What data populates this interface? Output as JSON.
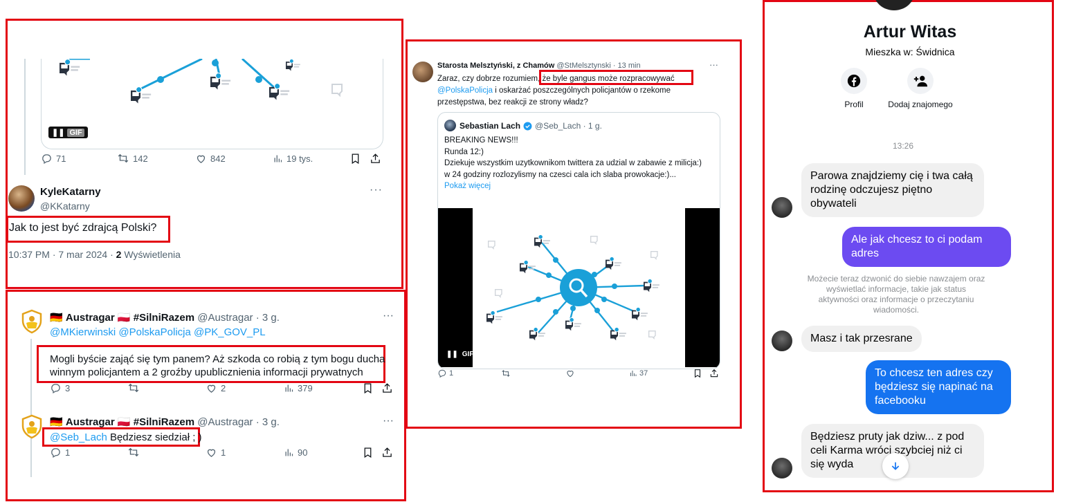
{
  "panel1": {
    "gif_label": "GIF",
    "stats": {
      "replies": "71",
      "retweets": "142",
      "likes": "842",
      "views": "19 tys."
    },
    "user": {
      "name": "KyleKatarny",
      "handle": "@KKatarny"
    },
    "tweet_text": "Jak to jest być zdrajcą Polski?",
    "time": "10:37 PM · 7 mar 2024 · ",
    "views_count": "2",
    "views_label": " Wyświetlenia"
  },
  "panel2": {
    "reply1": {
      "flag_de": "🇩🇪",
      "name": "Austragar",
      "flag_pl": "🇵🇱",
      "hashtag": "#SilniRazem",
      "handle_time": "@Austragar · 3 g.",
      "mentions": "@MKierwinski @PolskaPolicja @PK_GOV_PL",
      "text_line1": "Mogli byście zająć się tym panem? Aż szkoda co robią z tym bogu ducha",
      "text_line2": "winnym policjantem a 2 groźby upublicznienia informacji prywatnych",
      "stats": {
        "replies": "3",
        "retweets": "",
        "likes": "2",
        "views": "379"
      }
    },
    "reply2": {
      "name": "Austragar",
      "hashtag": "#SilniRazem",
      "handle_time": "@Austragar · 3 g.",
      "mention": "@Seb_Lach",
      "text": " Będziesz siedział ; )",
      "stats": {
        "replies": "1",
        "retweets": "",
        "likes": "1",
        "views": "90"
      }
    }
  },
  "panel3": {
    "header_name": "Starosta Melsztyński, z Chamów",
    "header_handle": "@StMelsztynski · 13 min",
    "text_pre": "Zaraz, czy dobrze rozumiem, ",
    "text_highlight": "że byle gangus może rozpracowywać",
    "text_mention": "@PolskaPolicja",
    "text_rest": " i oskarżać poszczególnych policjantów o rzekome przestępstwa, bez reakcji ze strony władz?",
    "quote": {
      "name": "Sebastian Lach",
      "handle_time": "@Seb_Lach · 1 g.",
      "lines": [
        "BREAKING NEWS!!!",
        "Runda 12:)",
        "Dziekuje wszystkim uzytkownikom twittera za udzial w zabawie z milicja:)",
        "w 24 godziny rozlozylismy na czesci cala ich slaba prowokacje:)..."
      ],
      "show_more": "Pokaż więcej",
      "gif_label": "GIF"
    },
    "stats": {
      "replies": "1",
      "retweets": "",
      "likes": "",
      "views": "37"
    }
  },
  "panel4": {
    "name": "Artur Witas",
    "location": "Mieszka w: Świdnica",
    "profile_label": "Profil",
    "add_friend_label": "Dodaj znajomego",
    "timestamp": "13:26",
    "messages": [
      {
        "dir": "in",
        "text": "Parowa znajdziemy cię i twa całą rodzinę odczujesz piętno obywateli"
      },
      {
        "dir": "out",
        "text": "Ale jak chcesz to ci podam adres"
      },
      {
        "dir": "in",
        "text": "Masz i tak przesrane"
      },
      {
        "dir": "out",
        "text": "To chcesz ten adres czy będziesz się napinać na facebooku"
      },
      {
        "dir": "in",
        "text": "Będziesz pruty jak dziw... z pod celi Karma wróci szybciej niż ci się wyda"
      }
    ],
    "system_note": "Możecie teraz dzwonić do siebie nawzajem oraz wyświetlać informacje, takie jak status aktywności oraz informacje o przeczytaniu wiadomości.",
    "colors": {
      "out_violet": "#6c4bf1",
      "out_blue": "#1573f0",
      "in_gray": "#f0f0f0"
    }
  },
  "colors": {
    "highlight_box": "#e30613",
    "twitter_link": "#1d9bf0"
  }
}
